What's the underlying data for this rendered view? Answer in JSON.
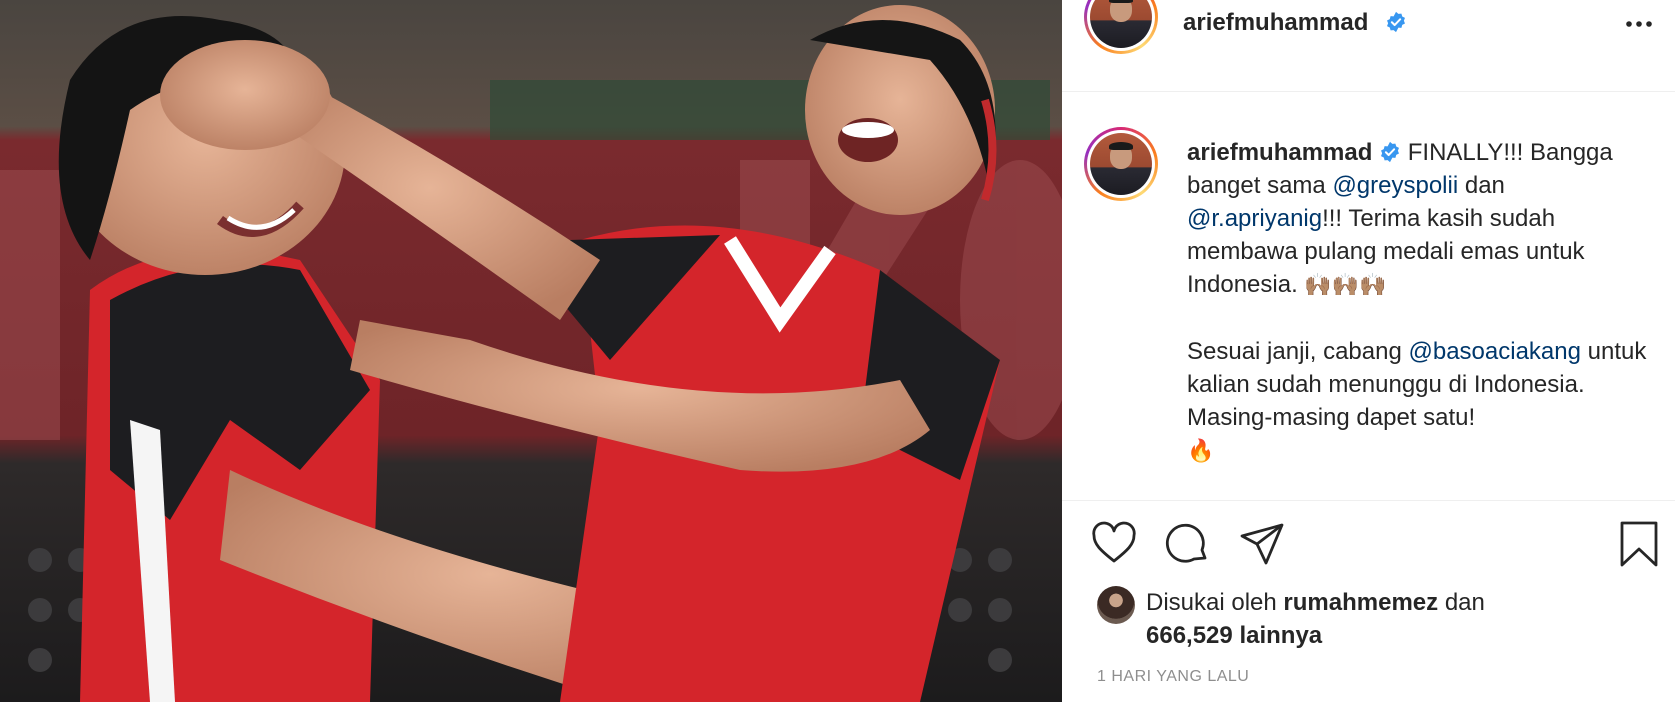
{
  "post": {
    "username": "ariefmuhammad",
    "verified": true,
    "more_icon": "more-horizontal-icon",
    "photo_description_icon": "post-photo"
  },
  "caption": {
    "username": "ariefmuhammad",
    "segments": {
      "s1": "FINALLY!!! Bangga banget sama ",
      "m1": "@greyspolii",
      "s2": " dan ",
      "m2": "@r.apriyanig",
      "s3": "!!! Terima kasih sudah membawa pulang medali emas untuk Indonesia. ",
      "e1": "🙌🏽🙌🏽🙌🏽",
      "s4": "Sesuai janji, cabang ",
      "m3": "@basoaciakang",
      "s5": " untuk kalian sudah menunggu di Indonesia. Masing-masing dapet satu!",
      "e2": "🔥"
    }
  },
  "actions": {
    "like_icon": "heart-icon",
    "comment_icon": "comment-icon",
    "share_icon": "paper-plane-icon",
    "save_icon": "bookmark-icon"
  },
  "likes": {
    "prefix": "Disukai oleh",
    "user": "rumahmemez",
    "conjunction": "dan",
    "count": "666,529",
    "suffix": "lainnya"
  },
  "timestamp": "1 HARI YANG LALU",
  "colors": {
    "mention": "#00376b",
    "verified": "#3897f0",
    "text": "#262626",
    "muted": "#8e8e8e"
  }
}
